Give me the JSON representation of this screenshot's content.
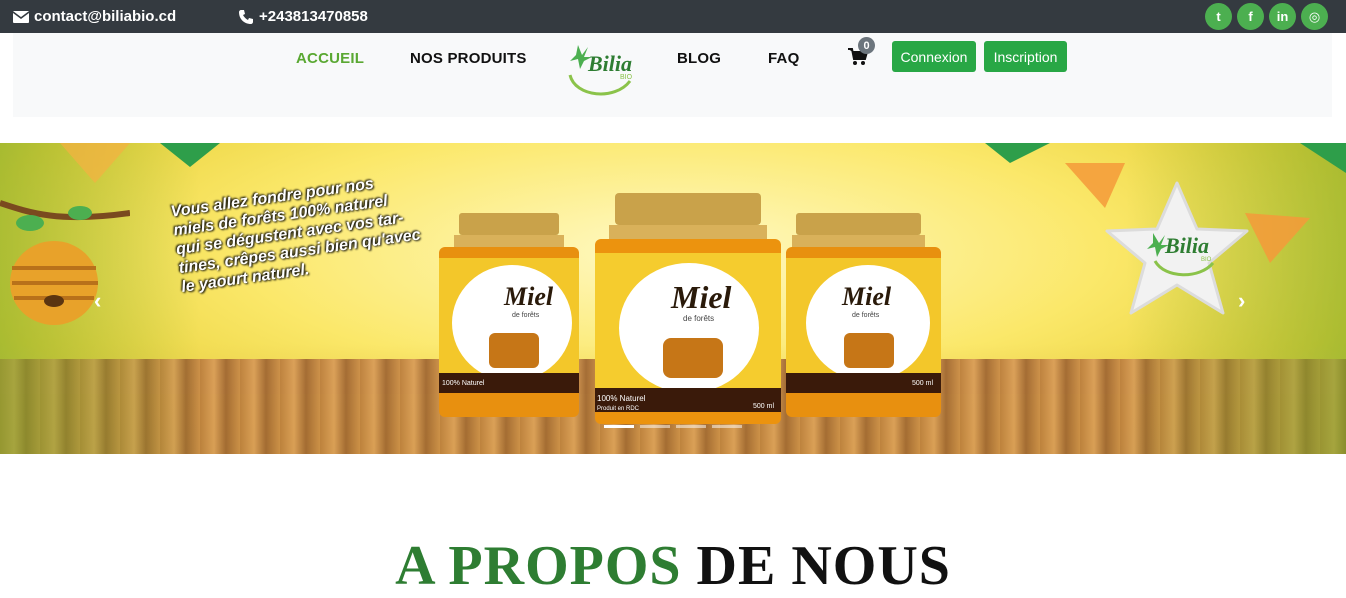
{
  "topbar": {
    "email": "contact@biliabio.cd",
    "phone": "+243813470858",
    "social": [
      {
        "icon": "twitter-icon",
        "glyph": "t"
      },
      {
        "icon": "facebook-icon",
        "glyph": "f"
      },
      {
        "icon": "linkedin-icon",
        "glyph": "in"
      },
      {
        "icon": "instagram-icon",
        "glyph": "◎"
      }
    ]
  },
  "nav": {
    "accueil": "ACCUEIL",
    "produits": "NOS PRODUITS",
    "blog": "BLOG",
    "faq": "FAQ",
    "cart_count": "0",
    "login": "Connexion",
    "signup": "Inscription",
    "logo_text": "Bilia",
    "logo_sub": "BIO"
  },
  "hero": {
    "tagline_1": "Vous allez fondre pour nos",
    "tagline_2a": "miels de forêts ",
    "tagline_2b": "100% naturel",
    "tagline_3a": "qui se ",
    "tagline_3b": "dégustent",
    "tagline_3c": " avec vos tar-",
    "tagline_4": "tines, crêpes aussi bien qu'avec",
    "tagline_5": "le yaourt naturel.",
    "jar_title": "Miel",
    "jar_sub": "de forêts",
    "jar_label": "100% Naturel",
    "jar_origin": "Produit en RDC",
    "jar_size": "500 ml",
    "badge_text": "Bilia",
    "badge_sub": "BIO",
    "slides_active": 1,
    "slides_total": 4
  },
  "about": {
    "title_green": "A PROPOS",
    "title_dark": "DE NOUS"
  },
  "colors": {
    "green": "#28a745",
    "accent": "#5aa832",
    "dark_bar": "#343a40"
  }
}
